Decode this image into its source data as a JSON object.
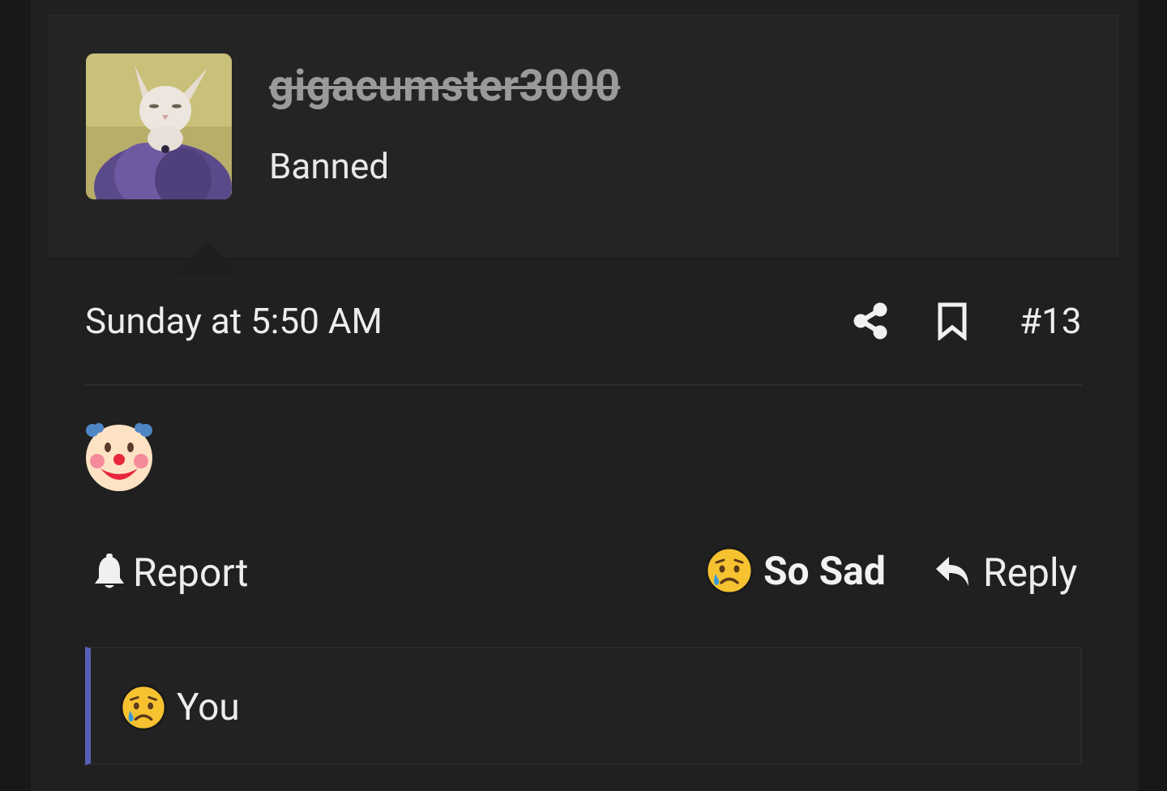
{
  "user": {
    "username": "gigacumster3000",
    "title": "Banned",
    "avatar_icon": "cat-avatar"
  },
  "post": {
    "date": "Sunday at 5:50 AM",
    "number": "#13",
    "content_emoji": "clown-face"
  },
  "actions": {
    "report_label": "Report",
    "reaction_label": "So Sad",
    "reply_label": "Reply"
  },
  "reactions_summary": {
    "label": "You",
    "emoji": "crying-face"
  },
  "colors": {
    "background": "#202020",
    "user_block": "#242424",
    "accent_border": "#5a5fb8",
    "username_muted": "#9a9a9a"
  }
}
